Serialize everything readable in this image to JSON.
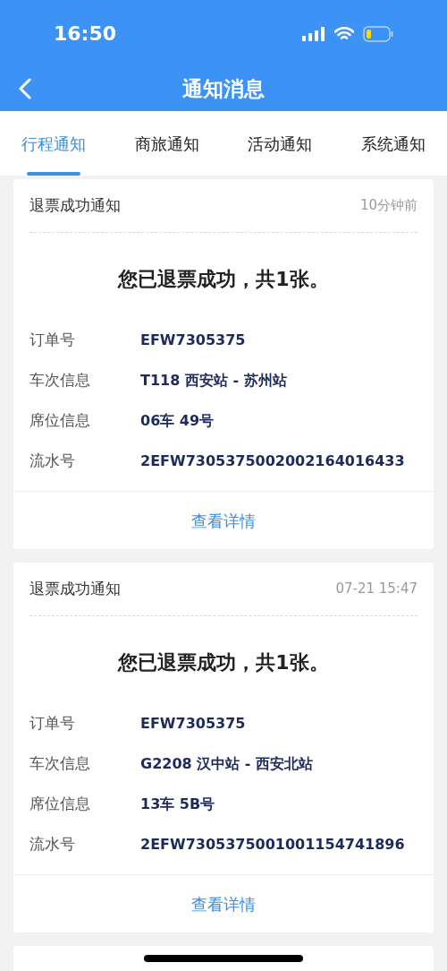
{
  "status_bar": {
    "time": "16:50"
  },
  "nav": {
    "title": "通知消息"
  },
  "tabs": [
    {
      "label": "行程通知",
      "selected": true
    },
    {
      "label": "商旅通知",
      "selected": false
    },
    {
      "label": "活动通知",
      "selected": false
    },
    {
      "label": "系统通知",
      "selected": false
    }
  ],
  "notifications": [
    {
      "title": "退票成功通知",
      "time": "10分钟前",
      "headline": "您已退票成功，共1张。",
      "fields": [
        {
          "label": "订单号",
          "value": "EFW7305375"
        },
        {
          "label": "车次信息",
          "value": "T118 西安站 - 苏州站"
        },
        {
          "label": "席位信息",
          "value": "06车 49号"
        },
        {
          "label": "流水号",
          "value": "2EFW7305375002002164016433"
        }
      ],
      "link": "查看详情"
    },
    {
      "title": "退票成功通知",
      "time": "07-21 15:47",
      "headline": "您已退票成功，共1张。",
      "fields": [
        {
          "label": "订单号",
          "value": "EFW7305375"
        },
        {
          "label": "车次信息",
          "value": "G2208 汉中站 - 西安北站"
        },
        {
          "label": "席位信息",
          "value": "13车 5B号"
        },
        {
          "label": "流水号",
          "value": "2EFW7305375001001154741896"
        }
      ],
      "link": "查看详情"
    }
  ]
}
